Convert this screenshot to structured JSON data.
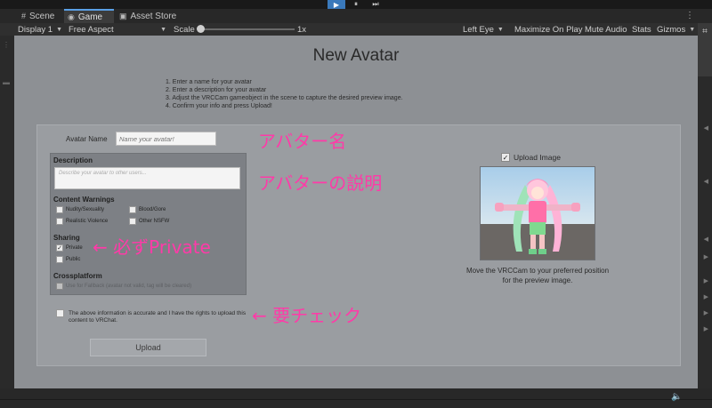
{
  "toolbar": {
    "play_icon": "▶",
    "pause_icon": "⏸",
    "step_icon": "⏭"
  },
  "tabs": [
    {
      "label": "Scene",
      "icon": "#"
    },
    {
      "label": "Game",
      "icon": "◉"
    },
    {
      "label": "Asset Store",
      "icon": "▣"
    }
  ],
  "game_bar": {
    "display": "Display 1",
    "aspect": "Free Aspect",
    "scale_label": "Scale",
    "scale_value": "1x",
    "eye": "Left Eye",
    "maximize": "Maximize On Play",
    "mute": "Mute Audio",
    "stats": "Stats",
    "gizmos": "Gizmos"
  },
  "form": {
    "title": "New Avatar",
    "instructions": [
      "1. Enter a name for your avatar",
      "2. Enter a description for your avatar",
      "3. Adjust the VRCCam gameobject in the scene to capture the desired preview image.",
      "4. Confirm your info and press Upload!"
    ],
    "name_label": "Avatar Name",
    "name_placeholder": "Name your avatar!",
    "description_title": "Description",
    "description_placeholder": "Describe your avatar to other users...",
    "content_warnings_title": "Content Warnings",
    "warnings": [
      "Nudity/Sexuality",
      "Blood/Gore",
      "Realistic Violence",
      "Other NSFW"
    ],
    "sharing_title": "Sharing",
    "sharing_private": "Private",
    "sharing_public": "Public",
    "crossplatform_title": "Crossplatform",
    "fallback_label": "Use for Fallback (avatar not valid, tag will be cleared)",
    "accept_text": "The above information is accurate and I have the rights to upload this content to VRChat.",
    "upload_button": "Upload",
    "upload_image_label": "Upload Image",
    "preview_caption": "Move the VRCCam to your preferred position for the preview image."
  },
  "annotations": {
    "name": "アバター名",
    "description": "アバターの説明",
    "private": "← 必ずPrivate",
    "check": "← 要チェック"
  },
  "colors": {
    "annotation": "#ff3aa8",
    "accent": "#3a79bb"
  }
}
